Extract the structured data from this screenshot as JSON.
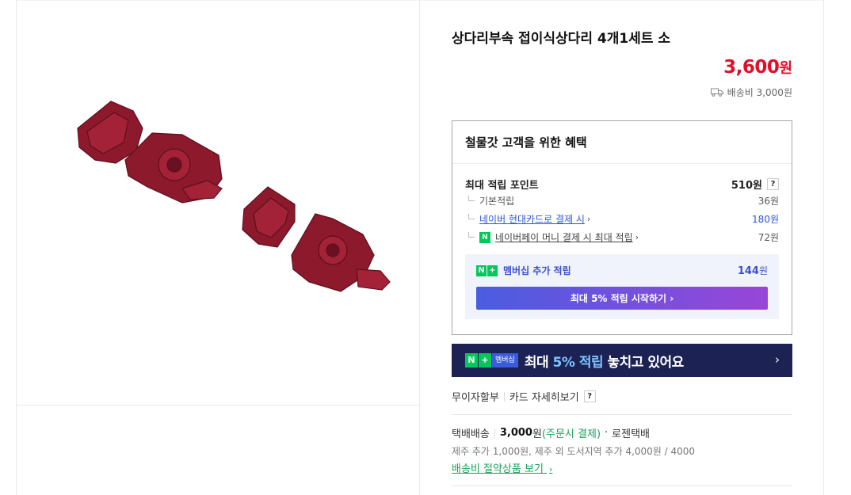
{
  "product": {
    "title": "상다리부속 접이식상다리 4개1세트 소",
    "price": "3,600",
    "price_unit": "원",
    "shipping_fee": "배송비 3,000원"
  },
  "benefit": {
    "heading": "철물갓 고객을 위한 혜택",
    "max_points_label": "최대 적립 포인트",
    "max_points_value": "510원",
    "rows": [
      {
        "label": "기본적립",
        "value": "36원"
      },
      {
        "label": "네이버 현대카드로 결제 시",
        "value": "180원"
      },
      {
        "label": "네이버페이 머니 결제 시 최대 적립",
        "value": "72원"
      }
    ],
    "help": "?",
    "membership_label": "멤버십 추가 적립",
    "membership_amount": "144",
    "membership_unit": "원",
    "start_button": "최대 5% 적립 시작하기",
    "npay_badge": "N"
  },
  "banner": {
    "badge_n": "N",
    "badge_plus": "+",
    "badge_text": "멤버십",
    "text_before": "최대 ",
    "text_highlight": "5% 적립",
    "text_after": " 놓치고 있어요",
    "arrow": "›"
  },
  "card": {
    "installment": "무이자할부",
    "detail": "카드 자세히보기",
    "help": "?"
  },
  "delivery": {
    "type": "택배배송",
    "fee": "3,000",
    "fee_unit": "원",
    "pay_note": "(주문시 결제)",
    "dot": "·",
    "courier": "로젠택배",
    "extra_fee": "제주 추가 1,000원, 제주 외 도서지역 추가 4,000원 / 4000",
    "saving_link": "배송비 절약상품 보기"
  },
  "colors": {
    "price_red": "#e00f29",
    "naver_green": "#03c75a",
    "membership_blue": "#3a4ed0",
    "banner_navy": "#1c2354"
  }
}
